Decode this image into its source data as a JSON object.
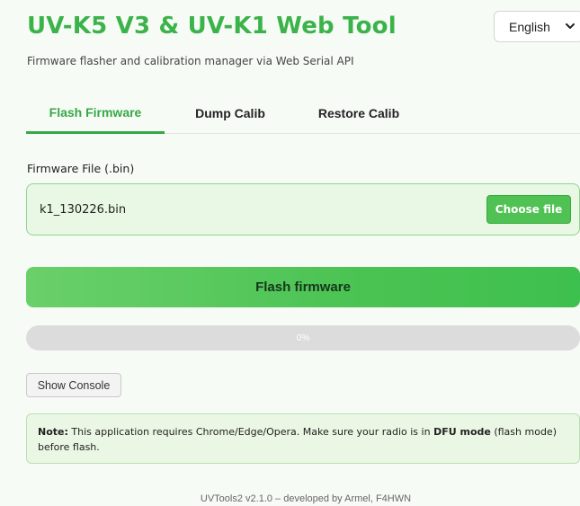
{
  "header": {
    "title": "UV-K5 V3 & UV-K1 Web Tool",
    "subtitle": "Firmware flasher and calibration manager via Web Serial API",
    "language": "English"
  },
  "tabs": [
    {
      "label": "Flash Firmware",
      "active": true
    },
    {
      "label": "Dump Calib",
      "active": false
    },
    {
      "label": "Restore Calib",
      "active": false
    }
  ],
  "firmware": {
    "label": "Firmware File (.bin)",
    "file_name": "k1_130226.bin",
    "choose_label": "Choose file"
  },
  "flash_label": "Flash firmware",
  "progress": {
    "percent": 0,
    "text": "0%"
  },
  "console_label": "Show Console",
  "note": {
    "prefix": "Note:",
    "text1": " This application requires Chrome/Edge/Opera. Make sure your radio is in ",
    "mode": "DFU mode",
    "text2": " (flash mode) before flash."
  },
  "footer": "UVTools2 v2.1.0 – developed by Armel, F4HWN",
  "colors": {
    "accent": "#3cb34a",
    "button": "#4fc253",
    "note_bg": "#eaf7e4"
  },
  "icons": {
    "language_chevron": "chevron-down-icon"
  }
}
